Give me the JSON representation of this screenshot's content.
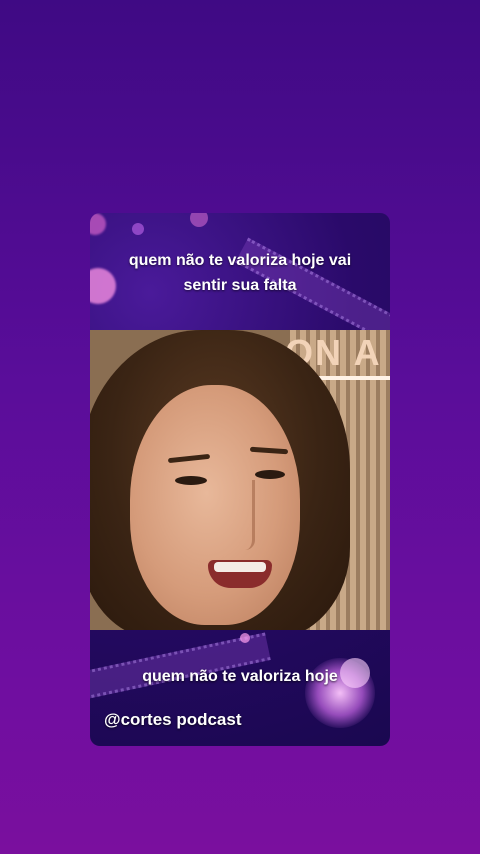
{
  "card": {
    "caption_top": "quem não te valoriza hoje vai sentir sua falta",
    "photo": {
      "background_sign_text": "ON A"
    },
    "caption_bottom": "quem não te valoriza hoje",
    "handle": "@cortes podcast"
  },
  "colors": {
    "background_top": "#3f0a84",
    "background_bottom": "#7a0f9e",
    "caption_text": "#ffffff"
  }
}
